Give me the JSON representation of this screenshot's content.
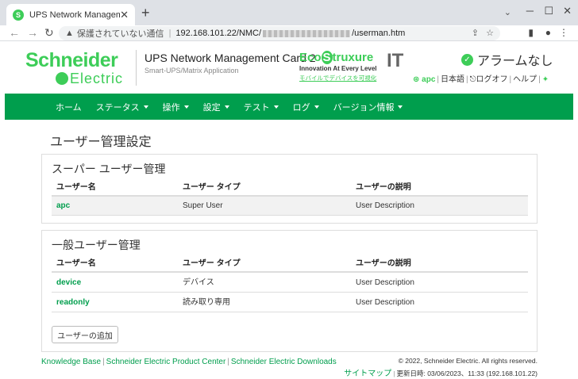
{
  "browser": {
    "tab_title": "UPS Network Management Ca",
    "insecure_label": "保護されていない通信",
    "url_prefix": "192.168.101.22/NMC/",
    "url_suffix": "/userman.htm"
  },
  "header": {
    "logo_line1": "Schneider",
    "logo_line2": "Electric",
    "product_title": "UPS Network Management Card 2",
    "product_subtitle": "Smart-UPS/Matrix Application",
    "eco_brand_a": "Eco",
    "eco_brand_b": "truxure",
    "eco_tagline": "Innovation At Every Level",
    "eco_link": "モバイルでデバイスを可視化",
    "it": "IT",
    "alarm": "アラームなし",
    "user": "apc",
    "language": "日本語",
    "logoff": "ログオフ",
    "help": "ヘルプ"
  },
  "menu": [
    {
      "label": "ホーム",
      "dropdown": false
    },
    {
      "label": "ステータス",
      "dropdown": true
    },
    {
      "label": "操作",
      "dropdown": true
    },
    {
      "label": "設定",
      "dropdown": true
    },
    {
      "label": "テスト",
      "dropdown": true
    },
    {
      "label": "ログ",
      "dropdown": true
    },
    {
      "label": "バージョン情報",
      "dropdown": true
    }
  ],
  "page_title": "ユーザー管理設定",
  "super_panel": {
    "title": "スーパー ユーザー管理",
    "headers": [
      "ユーザー名",
      "ユーザー タイプ",
      "ユーザーの説明"
    ],
    "rows": [
      {
        "name": "apc",
        "type": "Super User",
        "desc": "User Description"
      }
    ]
  },
  "general_panel": {
    "title": "一般ユーザー管理",
    "headers": [
      "ユーザー名",
      "ユーザー タイプ",
      "ユーザーの説明"
    ],
    "rows": [
      {
        "name": "device",
        "type": "デバイス",
        "desc": "User Description"
      },
      {
        "name": "readonly",
        "type": "読み取り専用",
        "desc": "User Description"
      }
    ],
    "add_button": "ユーザーの追加"
  },
  "footer": {
    "links": [
      "Knowledge Base",
      "Schneider Electric Product Center",
      "Schneider Electric Downloads"
    ],
    "copyright": "© 2022, Schneider Electric. All rights reserved.",
    "sitemap": "サイトマップ",
    "updated": "更新日時: 03/06/2023、11:33 (192.168.101.22)"
  },
  "colors": {
    "brand_green": "#3dcd58",
    "menu_green": "#009e4d"
  }
}
